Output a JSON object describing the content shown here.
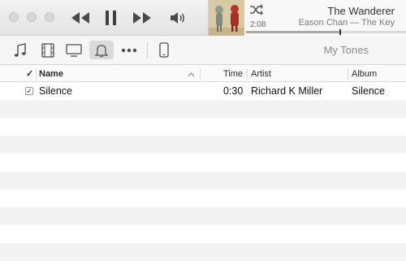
{
  "player": {
    "now_playing": {
      "title": "The Wanderer",
      "artist_album": "Eason Chan — The Key",
      "elapsed": "2:08",
      "progress": 0.59
    }
  },
  "toolbar": {
    "section_title": "My Tones"
  },
  "table": {
    "headers": {
      "check": "✓",
      "name": "Name",
      "time": "Time",
      "artist": "Artist",
      "album": "Album"
    },
    "rows": [
      {
        "checked": true,
        "name": "Silence",
        "time": "0:30",
        "artist": "Richard K Miller",
        "album": "Silence"
      }
    ]
  },
  "icons": {
    "close": "window-close-icon",
    "minimize": "window-minimize-icon",
    "zoom": "window-zoom-icon",
    "previous": "rewind-icon",
    "play_pause": "pause-icon",
    "next": "fast-forward-icon",
    "volume": "volume-icon",
    "shuffle": "shuffle-icon",
    "music": "music-note-icon",
    "movies": "film-icon",
    "tv": "tv-icon",
    "tones": "bell-icon",
    "more": "more-icon",
    "device": "iphone-icon",
    "sort": "sort-ascending-icon"
  }
}
